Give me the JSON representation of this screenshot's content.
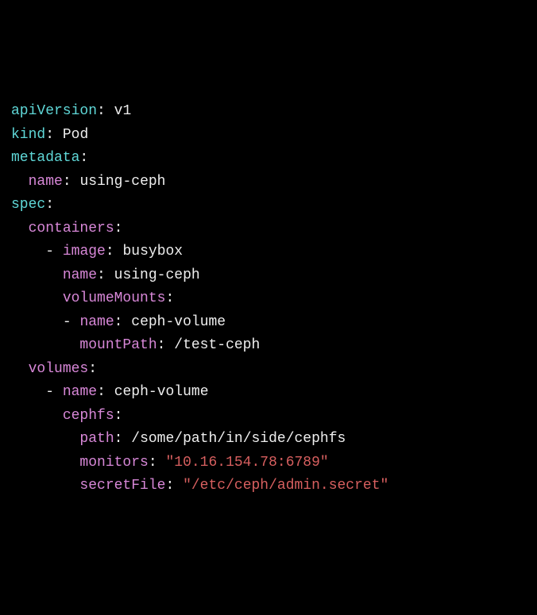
{
  "yaml": {
    "apiVersion": {
      "key": "apiVersion",
      "value": "v1"
    },
    "kind": {
      "key": "kind",
      "value": "Pod"
    },
    "metadata": {
      "key": "metadata"
    },
    "metadata_name": {
      "key": "name",
      "value": "using-ceph"
    },
    "spec": {
      "key": "spec"
    },
    "containers": {
      "key": "containers"
    },
    "image": {
      "key": "image",
      "value": "busybox"
    },
    "container_name": {
      "key": "name",
      "value": "using-ceph"
    },
    "volumeMounts": {
      "key": "volumeMounts"
    },
    "vm_name": {
      "key": "name",
      "value": "ceph-volume"
    },
    "mountPath": {
      "key": "mountPath",
      "value": "/test-ceph"
    },
    "volumes": {
      "key": "volumes"
    },
    "vol_name": {
      "key": "name",
      "value": "ceph-volume"
    },
    "cephfs": {
      "key": "cephfs"
    },
    "path": {
      "key": "path",
      "value": "/some/path/in/side/cephfs"
    },
    "monitors": {
      "key": "monitors",
      "value": "\"10.16.154.78:6789\""
    },
    "secretFile": {
      "key": "secretFile",
      "value": "\"/etc/ceph/admin.secret\""
    }
  }
}
